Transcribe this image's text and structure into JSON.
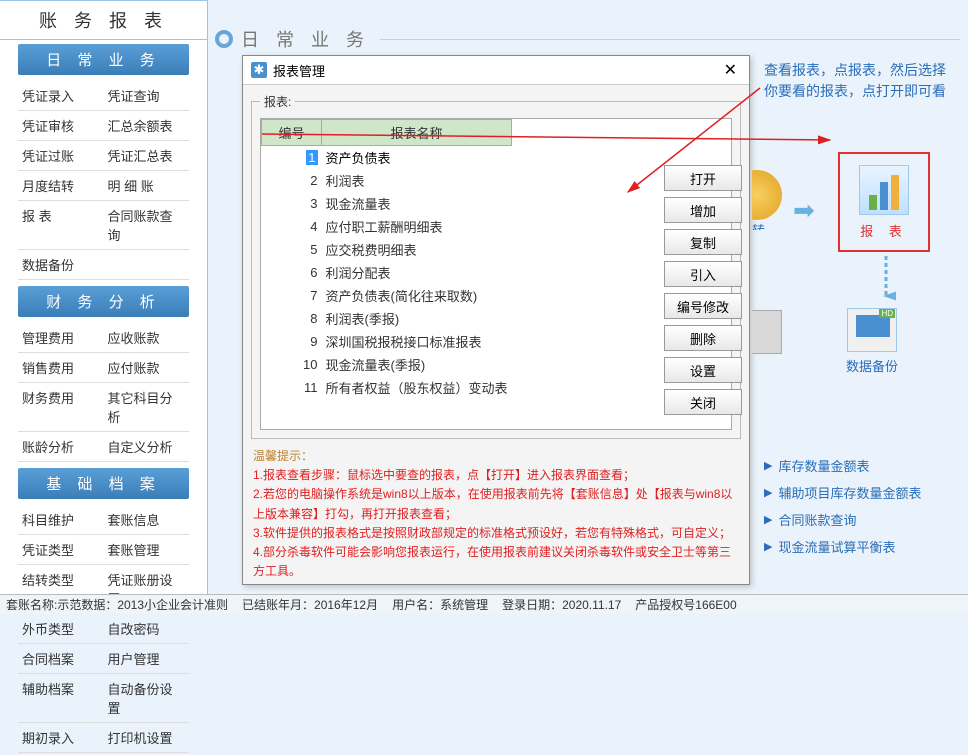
{
  "leftPanel": {
    "title": "账 务 报 表",
    "sections": [
      {
        "header": "日 常 业 务",
        "rows": [
          [
            "凭证录入",
            "凭证查询"
          ],
          [
            "凭证审核",
            "汇总余额表"
          ],
          [
            "凭证过账",
            "凭证汇总表"
          ],
          [
            "月度结转",
            "明  细  账"
          ],
          [
            "报    表",
            "合同账款查询"
          ],
          [
            "数据备份",
            ""
          ]
        ]
      },
      {
        "header": "财 务 分 析",
        "rows": [
          [
            "管理费用",
            "应收账款"
          ],
          [
            "销售费用",
            "应付账款"
          ],
          [
            "财务费用",
            "其它科目分析"
          ],
          [
            "账龄分析",
            "自定义分析"
          ]
        ]
      },
      {
        "header": "基 础 档 案",
        "rows": [
          [
            "科目维护",
            "套账信息"
          ],
          [
            "凭证类型",
            "套账管理"
          ],
          [
            "结转类型",
            "凭证账册设置"
          ],
          [
            "外币类型",
            "自改密码"
          ],
          [
            "合同档案",
            "用户管理"
          ],
          [
            "辅助档案",
            "自动备份设置"
          ],
          [
            "期初录入",
            "打印机设置"
          ]
        ]
      }
    ]
  },
  "topBanner": "日 常 业 务",
  "dialog": {
    "title": "报表管理",
    "legend": "报表:",
    "columns": {
      "num": "编号",
      "name": "报表名称"
    },
    "rows": [
      {
        "n": "1",
        "name": "资产负债表",
        "selected": true
      },
      {
        "n": "2",
        "name": "利润表"
      },
      {
        "n": "3",
        "name": "现金流量表"
      },
      {
        "n": "4",
        "name": "应付职工薪酬明细表"
      },
      {
        "n": "5",
        "name": "应交税费明细表"
      },
      {
        "n": "6",
        "name": "利润分配表"
      },
      {
        "n": "7",
        "name": "资产负债表(简化往来取数)"
      },
      {
        "n": "8",
        "name": "利润表(季报)"
      },
      {
        "n": "9",
        "name": "深圳国税报税接口标准报表"
      },
      {
        "n": "10",
        "name": "现金流量表(季报)"
      },
      {
        "n": "11",
        "name": "所有者权益（股东权益）变动表"
      }
    ],
    "buttons": [
      "打开",
      "增加",
      "复制",
      "引入",
      "编号修改",
      "删除",
      "设置",
      "关闭"
    ],
    "tipsHeader": "温馨提示：",
    "tipsBody": "1.报表查看步骤：鼠标选中要查的报表，点【打开】进入报表界面查看；\n2.若您的电脑操作系统是win8以上版本，在使用报表前先将【套账信息】处【报表与win8以上版本兼容】打勾，再打开报表查看；\n3.软件提供的报表格式是按照财政部规定的标准格式预设好，若您有特殊格式，可自定义；\n4.部分杀毒软件可能会影响您报表运行，在使用报表前建议关闭杀毒软件或安全卫士等第三方工具。"
  },
  "annotation": "查看报表，点报表，然后选择你要看的报表，点打开即可看",
  "icons": {
    "reportLabel": "报  表",
    "backupLabel": "数据备份",
    "transferLabel": "转"
  },
  "rightLinks": [
    "库存数量金额表",
    "辅助项目库存数量金额表",
    "合同账款查询",
    "现金流量试算平衡表"
  ],
  "statusBar": {
    "acct": "套账名称:示范数据：2013小企业会计准则",
    "period": "已结账年月：2016年12月",
    "user": "用户名：系统管理",
    "login": "登录日期：2020.11.17",
    "auth": "产品授权号166E00"
  }
}
